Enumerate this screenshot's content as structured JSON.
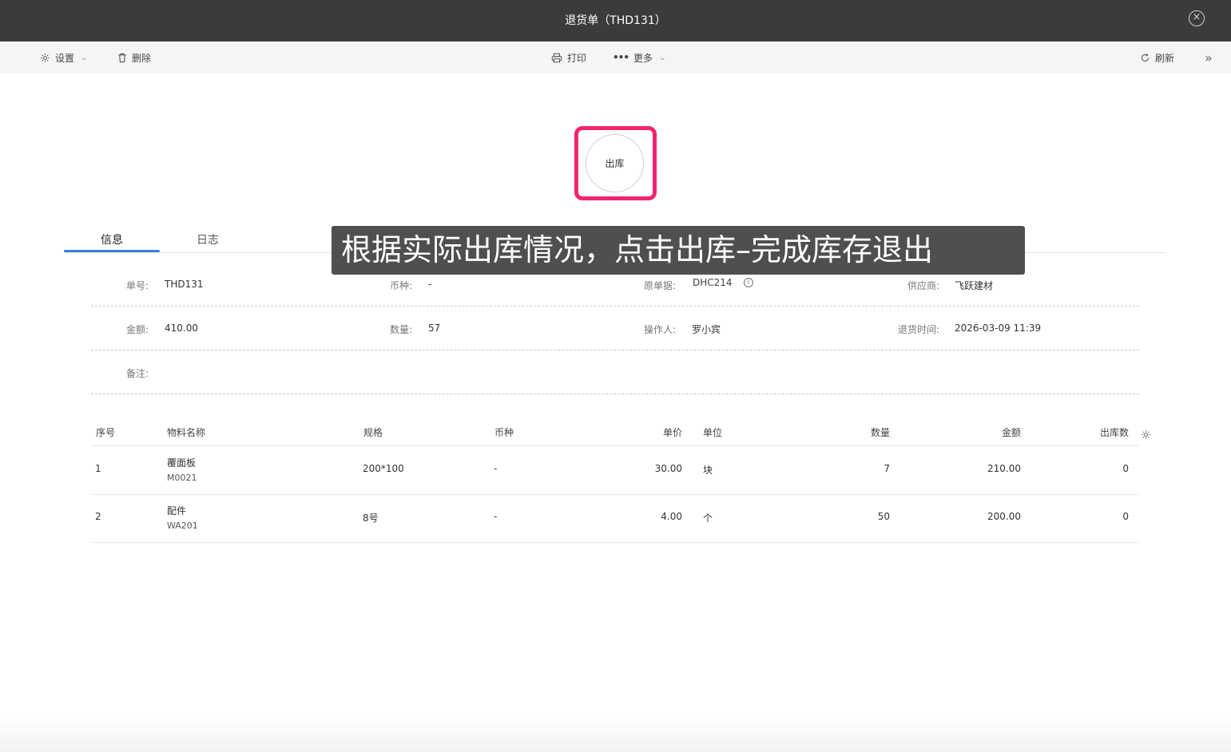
{
  "window": {
    "title": "退货单（THD131）"
  },
  "toolbar": {
    "settings_label": "设置",
    "delete_label": "删除",
    "print_label": "打印",
    "more_label": "更多",
    "refresh_label": "刷新",
    "chevron_down": "⌄",
    "collapse_glyph": "»"
  },
  "stamp": {
    "label": "出库"
  },
  "tabs": [
    {
      "label": "信息"
    },
    {
      "label": "日志"
    }
  ],
  "caption": "根据实际出库情况，点击出库–完成库存退出",
  "info": {
    "order_no_label": "单号:",
    "order_no": "THD131",
    "currency_label": "币种:",
    "currency": "-",
    "source_label": "原单据:",
    "source": "DHC214",
    "supplier_label": "供应商:",
    "supplier": "飞跃建材",
    "amount_label": "金额:",
    "amount": "410.00",
    "qty_label": "数量:",
    "qty": "57",
    "operator_label": "操作人:",
    "operator": "罗小宾",
    "return_time_label": "退货时间:",
    "return_time": "2026-03-09 11:39",
    "remark_label": "备注:"
  },
  "table": {
    "headers": [
      "序号",
      "物料名称",
      "规格",
      "币种",
      "单价",
      "单位",
      "数量",
      "金额",
      "出库数"
    ],
    "rows": [
      {
        "no": "1",
        "name": "覆面板",
        "code": "M0021",
        "spec": "200*100",
        "currency": "-",
        "price": "30.00",
        "unit": "块",
        "qty": "7",
        "amount": "210.00",
        "out": "0"
      },
      {
        "no": "2",
        "name": "配件",
        "code": "WA201",
        "spec": "8号",
        "currency": "-",
        "price": "4.00",
        "unit": "个",
        "qty": "50",
        "amount": "200.00",
        "out": "0"
      }
    ]
  },
  "colors": {
    "titlebar": "#3b3b3b",
    "accent": "#3b7fdd",
    "highlight": "#f0246e"
  }
}
